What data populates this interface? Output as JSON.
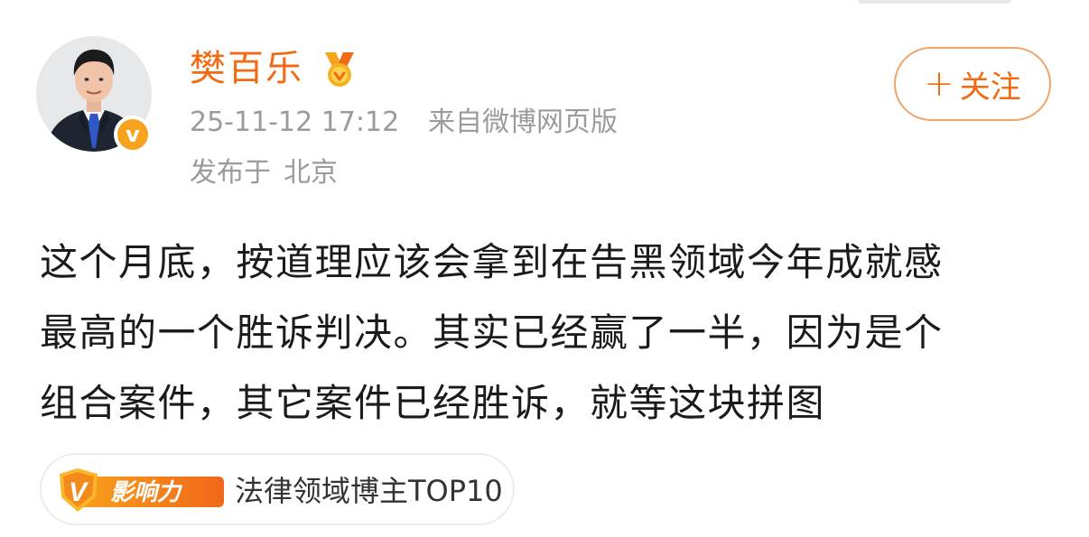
{
  "post": {
    "author": {
      "name": "樊百乐",
      "verified_mark": "v"
    },
    "timestamp": "25-11-12 17:12",
    "source": "来自微博网页版",
    "location_label": "发布于",
    "location": "北京",
    "follow_button": {
      "plus": "+",
      "label": "关注"
    },
    "text_lines": [
      "这个月底，按道理应该会拿到在告黑领域今年成就感",
      "最高的一个胜诉判决。其实已经赢了一半，因为是个",
      "组合案件，其它案件已经胜诉，就等这块拼图"
    ],
    "influence_tag": {
      "badge_letter": "V",
      "badge_label": "影响力",
      "text": "法律领域博主TOP10"
    }
  },
  "colors": {
    "accent": "#f26a12",
    "meta_gray": "#9b9b9b",
    "badge_orange": "#f7a31e"
  },
  "icons": {
    "avatar": "profile-photo",
    "verified": "verified-v-badge-icon",
    "medal": "medal-icon",
    "influence": "influence-v-icon"
  }
}
